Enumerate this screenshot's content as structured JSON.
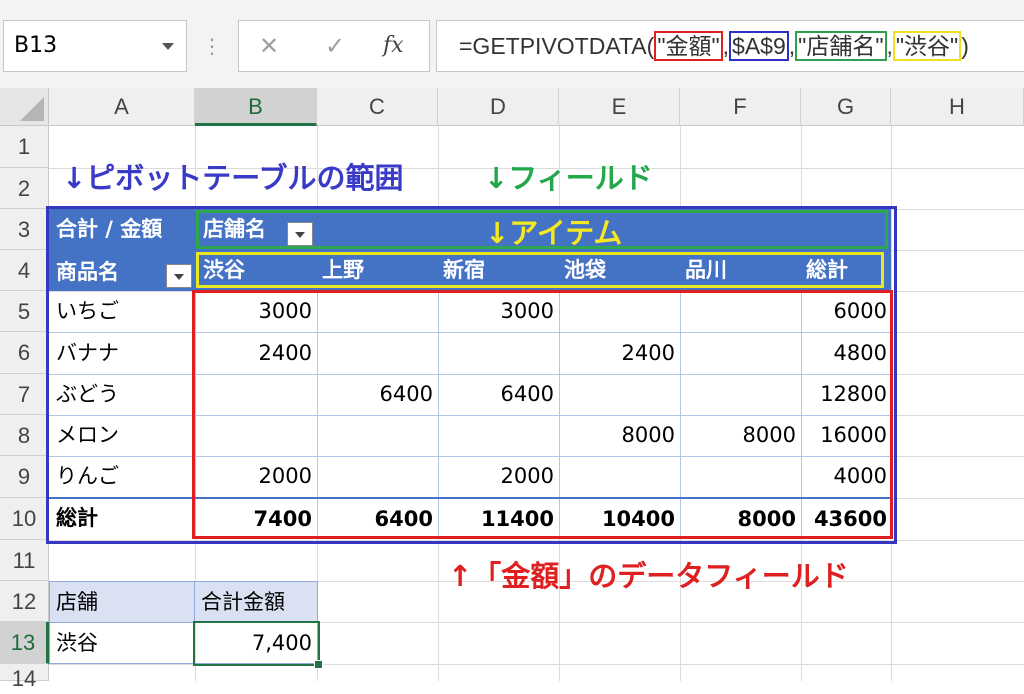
{
  "formula_bar": {
    "name_box": "B13",
    "dots": "⋮",
    "cancel": "✕",
    "enter": "✓",
    "fx": "fx",
    "formula_prefix": "=GETPIVOTDATA(",
    "arg1": "\"金額\"",
    "sep1": ",",
    "arg2": "$A$9",
    "sep2": ",",
    "arg3": "\"店舗名\"",
    "sep3": ",",
    "arg4": "\"渋谷\"",
    "formula_suffix": ")"
  },
  "columns": [
    "A",
    "B",
    "C",
    "D",
    "E",
    "F",
    "G",
    "H"
  ],
  "rows": [
    "1",
    "2",
    "3",
    "4",
    "5",
    "6",
    "7",
    "8",
    "9",
    "10",
    "11",
    "12",
    "13",
    "14"
  ],
  "annotations": {
    "range": "↓ピボットテーブルの範囲",
    "field": "↓フィールド",
    "item": "↓アイテム",
    "data_field": "↑「金額」のデータフィールド"
  },
  "pivot": {
    "corner_label": "合計 / 金額",
    "column_field": "店舗名",
    "row_field": "商品名",
    "column_items": [
      "渋谷",
      "上野",
      "新宿",
      "池袋",
      "品川",
      "総計"
    ],
    "rows": [
      {
        "label": "いちご",
        "values": [
          "3000",
          "",
          "3000",
          "",
          "",
          "6000"
        ]
      },
      {
        "label": "バナナ",
        "values": [
          "2400",
          "",
          "",
          "2400",
          "",
          "4800"
        ]
      },
      {
        "label": "ぶどう",
        "values": [
          "",
          "6400",
          "6400",
          "",
          "",
          "12800"
        ]
      },
      {
        "label": "メロン",
        "values": [
          "",
          "",
          "",
          "8000",
          "8000",
          "16000"
        ]
      },
      {
        "label": "りんご",
        "values": [
          "2000",
          "",
          "2000",
          "",
          "",
          "4000"
        ]
      }
    ],
    "total": {
      "label": "総計",
      "values": [
        "7400",
        "6400",
        "11400",
        "10400",
        "8000",
        "43600"
      ]
    }
  },
  "summary": {
    "h_store": "店舗",
    "h_total": "合計金額",
    "store": "渋谷",
    "amount": "7,400"
  },
  "colors": {
    "pivot_header": "#4472c4",
    "accent": "#217346",
    "range_box": "#3636c0",
    "field_box": "#2ea84f",
    "item_box": "#e8e820",
    "data_box": "#e02020"
  }
}
